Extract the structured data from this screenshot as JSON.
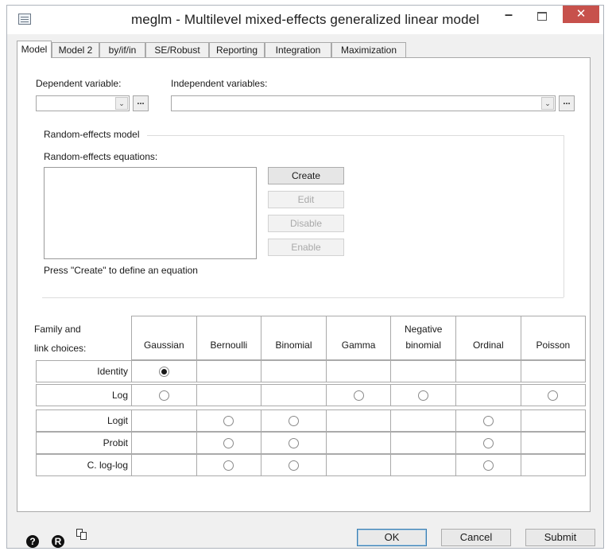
{
  "window": {
    "title": "meglm - Multilevel mixed-effects generalized linear model"
  },
  "titlebar_buttons": {
    "minimize": "–",
    "close": "✕"
  },
  "tabs": [
    "Model",
    "Model 2",
    "by/if/in",
    "SE/Robust",
    "Reporting",
    "Integration",
    "Maximization"
  ],
  "model": {
    "dependent_label": "Dependent variable:",
    "independent_label": "Independent variables:",
    "browse_label": "...",
    "combo_arrow": "⌄"
  },
  "random_effects": {
    "group_label": "Random-effects model",
    "equations_label": "Random-effects equations:",
    "buttons": {
      "create": "Create",
      "edit": "Edit",
      "disable": "Disable",
      "enable": "Enable"
    },
    "hint": "Press \"Create\" to define an equation"
  },
  "family_link": {
    "header_label_line1": "Family and",
    "header_label_line2": "link choices:",
    "families": [
      {
        "line1": "",
        "line2": "Gaussian"
      },
      {
        "line1": "",
        "line2": "Bernoulli"
      },
      {
        "line1": "",
        "line2": "Binomial"
      },
      {
        "line1": "",
        "line2": "Gamma"
      },
      {
        "line1": "Negative",
        "line2": "binomial"
      },
      {
        "line1": "",
        "line2": "Ordinal"
      },
      {
        "line1": "",
        "line2": "Poisson"
      }
    ],
    "links": [
      {
        "label": "Identity",
        "options": [
          true,
          false,
          false,
          false,
          false,
          false,
          false
        ],
        "selected": 0
      },
      {
        "label": "Log",
        "options": [
          true,
          false,
          false,
          true,
          true,
          false,
          true
        ],
        "selected": -1
      },
      {
        "label": "Logit",
        "options": [
          false,
          true,
          true,
          false,
          false,
          true,
          false
        ],
        "selected": -1
      },
      {
        "label": "Probit",
        "options": [
          false,
          true,
          true,
          false,
          false,
          true,
          false
        ],
        "selected": -1
      },
      {
        "label": "C. log-log",
        "options": [
          false,
          true,
          true,
          false,
          false,
          true,
          false
        ],
        "selected": -1
      }
    ]
  },
  "footer": {
    "help_icon": "?",
    "info_icon": "R",
    "ok": "OK",
    "cancel": "Cancel",
    "submit": "Submit"
  }
}
